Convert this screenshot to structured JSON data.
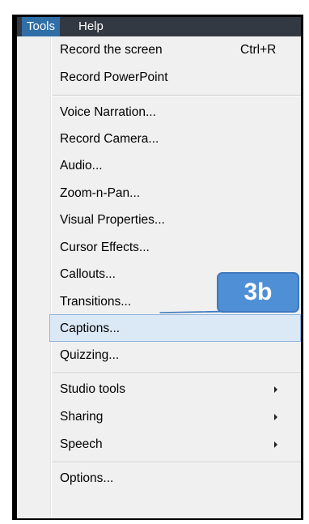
{
  "menubar": {
    "tools_label": "Tools",
    "help_label": "Help"
  },
  "menu": {
    "items": [
      {
        "label": "Record the screen",
        "shortcut": "Ctrl+R"
      },
      {
        "label": "Record PowerPoint"
      },
      {
        "label": "Voice Narration..."
      },
      {
        "label": "Record Camera..."
      },
      {
        "label": "Audio..."
      },
      {
        "label": "Zoom-n-Pan..."
      },
      {
        "label": "Visual Properties..."
      },
      {
        "label": "Cursor Effects..."
      },
      {
        "label": "Callouts..."
      },
      {
        "label": "Transitions..."
      },
      {
        "label": "Captions...",
        "highlighted": true
      },
      {
        "label": "Quizzing..."
      },
      {
        "label": "Studio tools",
        "submenu": true
      },
      {
        "label": "Sharing",
        "submenu": true
      },
      {
        "label": "Speech",
        "submenu": true
      },
      {
        "label": "Options..."
      }
    ]
  },
  "callout": {
    "text": "3b",
    "color": "#4f8fd6"
  },
  "colors": {
    "menubar_bg": "#333942",
    "tools_active_bg": "#2f6ea6",
    "highlight_bg": "#dbe8f6",
    "highlight_border": "#8fb4dc"
  }
}
